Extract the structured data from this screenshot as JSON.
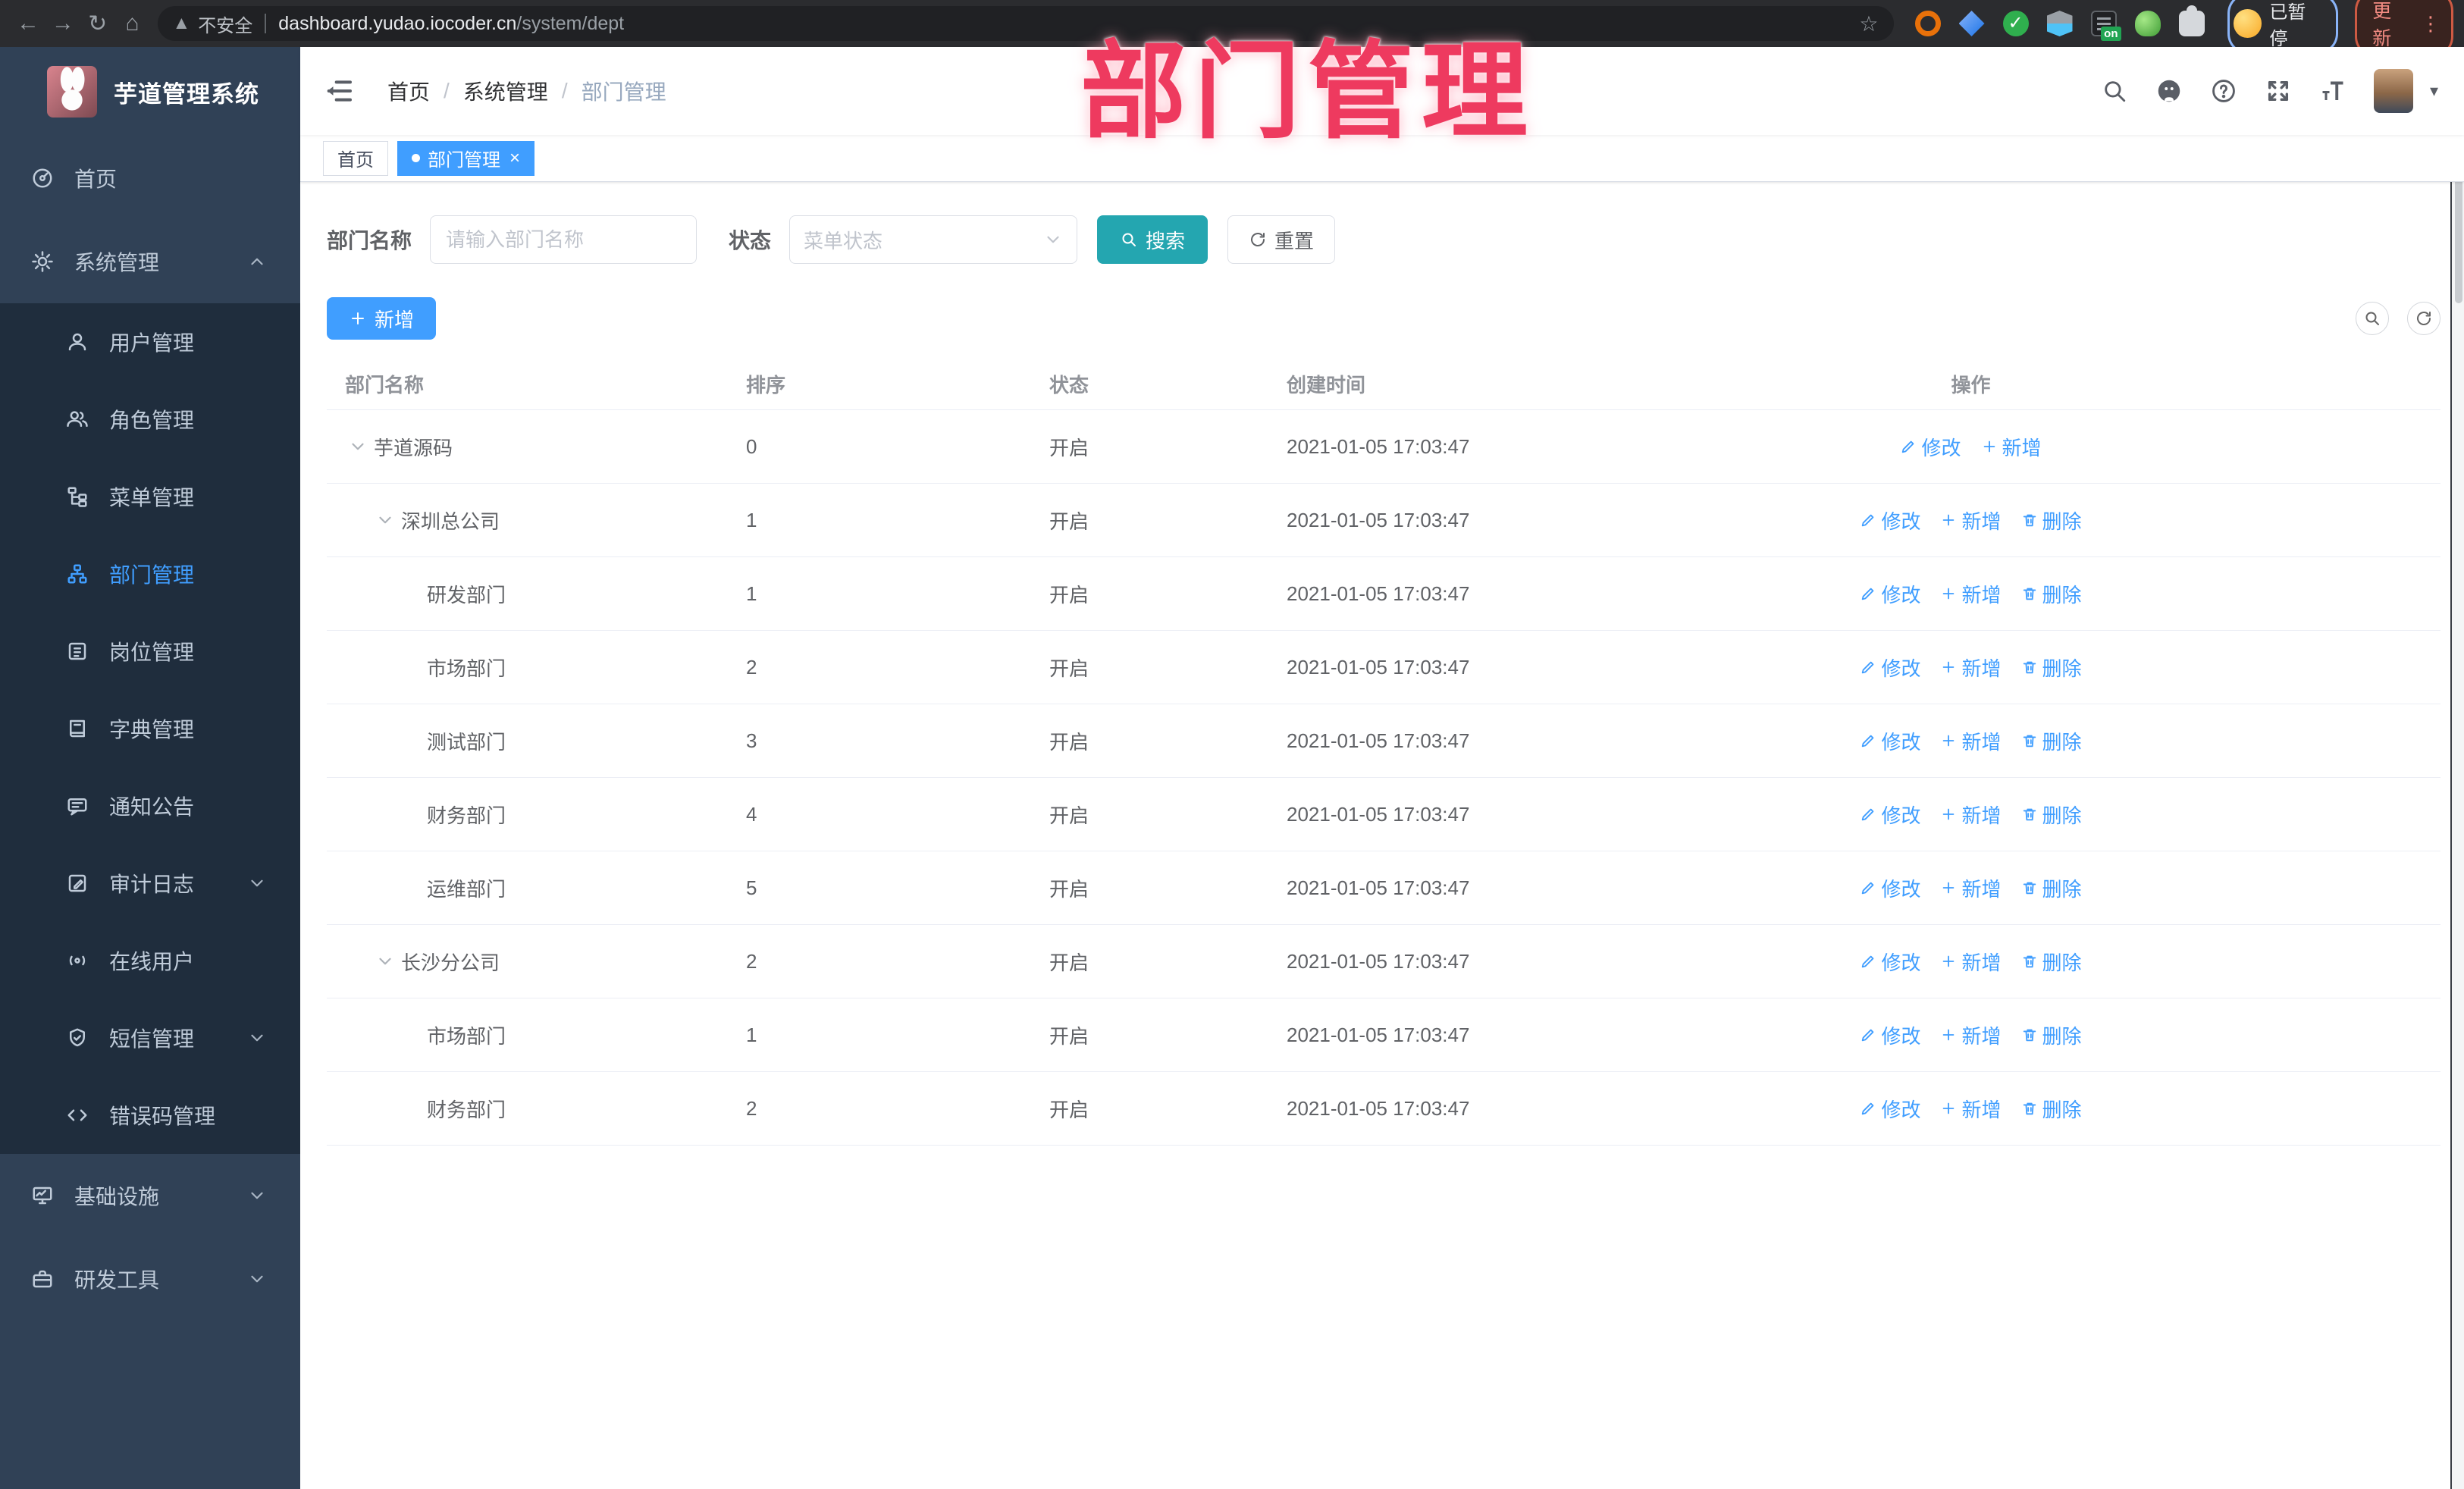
{
  "browser": {
    "security_label": "不安全",
    "url_host": "dashboard.yudao.iocoder.cn",
    "url_path": "/system/dept",
    "extension_badge": "on",
    "profile_chip": "已暂停",
    "update_button": "更新"
  },
  "overlay_title": "部门管理",
  "sidebar": {
    "app_title": "芋道管理系统",
    "items": [
      {
        "label": "首页"
      },
      {
        "label": "系统管理",
        "expanded": true
      },
      {
        "label": "用户管理"
      },
      {
        "label": "角色管理"
      },
      {
        "label": "菜单管理"
      },
      {
        "label": "部门管理",
        "active": true
      },
      {
        "label": "岗位管理"
      },
      {
        "label": "字典管理"
      },
      {
        "label": "通知公告"
      },
      {
        "label": "审计日志",
        "collapsed": true
      },
      {
        "label": "在线用户"
      },
      {
        "label": "短信管理",
        "collapsed": true
      },
      {
        "label": "错误码管理"
      },
      {
        "label": "基础设施",
        "collapsed": true
      },
      {
        "label": "研发工具",
        "collapsed": true
      }
    ]
  },
  "breadcrumb": {
    "items": [
      "首页",
      "系统管理",
      "部门管理"
    ]
  },
  "tags": [
    {
      "label": "首页",
      "active": false
    },
    {
      "label": "部门管理",
      "active": true
    }
  ],
  "filters": {
    "dept_name_label": "部门名称",
    "dept_name_placeholder": "请输入部门名称",
    "status_label": "状态",
    "status_placeholder": "菜单状态",
    "search_label": "搜索",
    "reset_label": "重置"
  },
  "toolbar": {
    "add_label": "新增"
  },
  "row_actions": {
    "edit": "修改",
    "add": "新增",
    "delete": "删除"
  },
  "table": {
    "columns": [
      "部门名称",
      "排序",
      "状态",
      "创建时间",
      "操作"
    ],
    "rows": [
      {
        "name": "芋道源码",
        "sort": "0",
        "status": "开启",
        "created": "2021-01-05 17:03:47",
        "level": 0,
        "expandable": true
      },
      {
        "name": "深圳总公司",
        "sort": "1",
        "status": "开启",
        "created": "2021-01-05 17:03:47",
        "level": 1,
        "expandable": true
      },
      {
        "name": "研发部门",
        "sort": "1",
        "status": "开启",
        "created": "2021-01-05 17:03:47",
        "level": 2
      },
      {
        "name": "市场部门",
        "sort": "2",
        "status": "开启",
        "created": "2021-01-05 17:03:47",
        "level": 2
      },
      {
        "name": "测试部门",
        "sort": "3",
        "status": "开启",
        "created": "2021-01-05 17:03:47",
        "level": 2
      },
      {
        "name": "财务部门",
        "sort": "4",
        "status": "开启",
        "created": "2021-01-05 17:03:47",
        "level": 2
      },
      {
        "name": "运维部门",
        "sort": "5",
        "status": "开启",
        "created": "2021-01-05 17:03:47",
        "level": 2
      },
      {
        "name": "长沙分公司",
        "sort": "2",
        "status": "开启",
        "created": "2021-01-05 17:03:47",
        "level": 1,
        "expandable": true
      },
      {
        "name": "市场部门",
        "sort": "1",
        "status": "开启",
        "created": "2021-01-05 17:03:47",
        "level": 2
      },
      {
        "name": "财务部门",
        "sort": "2",
        "status": "开启",
        "created": "2021-01-05 17:03:47",
        "level": 2
      }
    ]
  },
  "colors": {
    "accent": "#409eff",
    "link": "#409eff",
    "search_button_teal": "#24a6b0",
    "sidebar_bg": "#304156",
    "submenu_bg": "#1f2d3d",
    "active_tag": "#409eff",
    "overlay_pink": "#ee3a5f",
    "breadcrumb_muted": "#97a8be"
  }
}
